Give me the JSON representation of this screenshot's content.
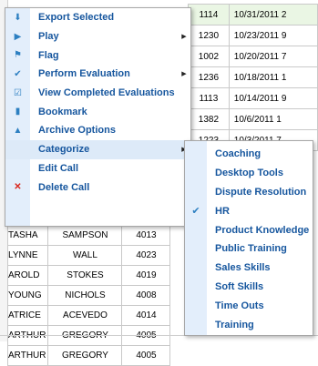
{
  "top_grid": {
    "rows": [
      {
        "first": "",
        "last": "",
        "id": "1114",
        "date": "10/31/2011 2"
      },
      {
        "first": "",
        "last": "",
        "id": "1230",
        "date": "10/23/2011 9"
      },
      {
        "first": "",
        "last": "",
        "id": "1002",
        "date": "10/20/2011 7"
      },
      {
        "first": "",
        "last": "",
        "id": "1236",
        "date": "10/18/2011 1"
      },
      {
        "first": "",
        "last": "",
        "id": "1113",
        "date": "10/14/2011 9"
      },
      {
        "first": "",
        "last": "",
        "id": "1382",
        "date": "10/6/2011 1"
      },
      {
        "first": "",
        "last": "",
        "id": "1223",
        "date": "10/3/2011 7"
      }
    ]
  },
  "bottom_grid": {
    "rows": [
      {
        "first": "TASHA",
        "last": "SAMPSON",
        "id": "4013"
      },
      {
        "first": "LYNNE",
        "last": "WALL",
        "id": "4023"
      },
      {
        "first": "AROLD",
        "last": "STOKES",
        "id": "4019"
      },
      {
        "first": "YOUNG",
        "last": "NICHOLS",
        "id": "4008"
      },
      {
        "first": "ATRICE",
        "last": "ACEVEDO",
        "id": "4014"
      },
      {
        "first": "ARTHUR",
        "last": "GREGORY",
        "id": "4005"
      },
      {
        "first": "ARTHUR",
        "last": "GREGORY",
        "id": "4005"
      }
    ]
  },
  "context_menu": {
    "items": [
      {
        "label": "Export Selected",
        "icon": "download-icon",
        "glyph": "⬇",
        "submenu": false
      },
      {
        "label": "Play",
        "icon": "play-icon",
        "glyph": "▶",
        "submenu": true
      },
      {
        "label": "Flag",
        "icon": "flag-icon",
        "glyph": "⚑",
        "submenu": false
      },
      {
        "label": "Perform Evaluation",
        "icon": "evaluate-check-icon",
        "glyph": "✔",
        "submenu": true
      },
      {
        "label": "View Completed Evaluations",
        "icon": "completed-evaluations-icon",
        "glyph": "☑",
        "submenu": false
      },
      {
        "label": "Bookmark",
        "icon": "bookmark-icon",
        "glyph": "▮",
        "submenu": false
      },
      {
        "label": "Archive Options",
        "icon": "archive-icon",
        "glyph": "▲",
        "submenu": false
      },
      {
        "label": "Categorize",
        "icon": "",
        "glyph": "",
        "submenu": true
      },
      {
        "label": "Edit Call",
        "icon": "",
        "glyph": "",
        "submenu": false
      },
      {
        "label": "Delete Call",
        "icon": "delete-x-icon",
        "glyph": "✕",
        "submenu": false
      }
    ],
    "submenu_arrow": "▶"
  },
  "categorize_submenu": {
    "items": [
      {
        "label": "Coaching",
        "checked": false
      },
      {
        "label": "Desktop Tools",
        "checked": false
      },
      {
        "label": "Dispute Resolution",
        "checked": false
      },
      {
        "label": "HR",
        "checked": true
      },
      {
        "label": "Product Knowledge",
        "checked": false
      },
      {
        "label": "Public Training",
        "checked": false
      },
      {
        "label": "Sales Skills",
        "checked": false
      },
      {
        "label": "Soft Skills",
        "checked": false
      },
      {
        "label": "Time Outs",
        "checked": false
      },
      {
        "label": "Training",
        "checked": false
      }
    ],
    "check_glyph": "✔"
  },
  "colors": {
    "menu_text": "#16569e",
    "icon_blue": "#2c7fc1",
    "delete_red": "#d9261c",
    "row_highlight": "#eaf6e4"
  }
}
